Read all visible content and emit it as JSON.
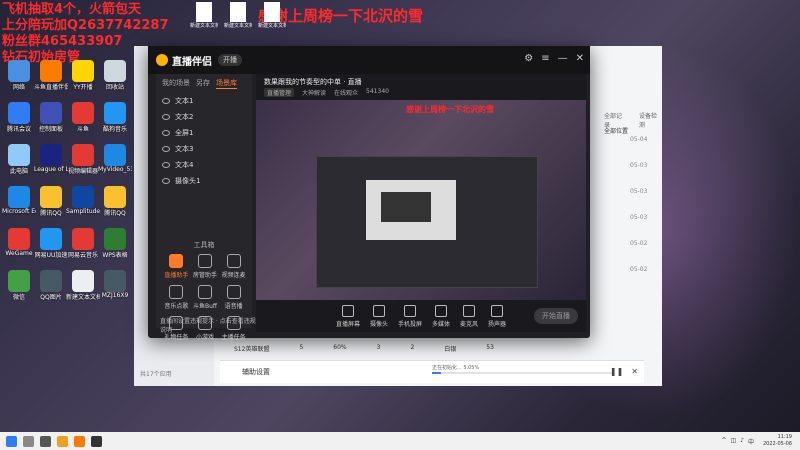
{
  "overlay": {
    "line1": "飞机抽取4个，火箭包天",
    "line2": "上分陪玩加Q2637742287",
    "line3": "粉丝群465433907",
    "line4": "钻石初始房管",
    "banner": "感谢上周榜一下北沢的雪"
  },
  "top_files": [
    "新建文本文档",
    "新建文本文档",
    "新建文本文档"
  ],
  "desktop_icons": [
    {
      "label": "网络",
      "color": "#4a90e2"
    },
    {
      "label": "斗鱼直播伴侣",
      "color": "#ff7a00"
    },
    {
      "label": "YY开播",
      "color": "#ffd400"
    },
    {
      "label": "回收站",
      "color": "#cfd8dc"
    },
    {
      "label": "腾讯会议",
      "color": "#2f7df6"
    },
    {
      "label": "控制面板",
      "color": "#3f51b5"
    },
    {
      "label": "斗鱼",
      "color": "#e53935"
    },
    {
      "label": "酷狗音乐",
      "color": "#2196f3"
    },
    {
      "label": "此电脑",
      "color": "#90caf9"
    },
    {
      "label": "League of Legends",
      "color": "#1a237e"
    },
    {
      "label": "视频编辑器",
      "color": "#e53935"
    },
    {
      "label": "MyVideo_53",
      "color": "#1e88e5"
    },
    {
      "label": "Microsoft Edge",
      "color": "#1e88e5"
    },
    {
      "label": "腾讯QQ",
      "color": "#fbc02d"
    },
    {
      "label": "SamplitudeProX",
      "color": "#0d47a1"
    },
    {
      "label": "腾讯QQ",
      "color": "#fbc02d"
    },
    {
      "label": "WeGame",
      "color": "#e53935"
    },
    {
      "label": "网易UU加速",
      "color": "#2196f3"
    },
    {
      "label": "网易云音乐",
      "color": "#e53935"
    },
    {
      "label": "WPS表格",
      "color": "#2e7d32"
    },
    {
      "label": "微信",
      "color": "#43a047"
    },
    {
      "label": "QQ图片",
      "color": "#455a64"
    },
    {
      "label": "新建文本文档",
      "color": "#eceff1"
    },
    {
      "label": "MZJ16X9",
      "color": "#455a64"
    }
  ],
  "main_window": {
    "app_name": "直播伴侣",
    "top_button": "开播",
    "left_tabs": [
      "我的场景",
      "另存",
      "场景库"
    ],
    "sources": [
      "文本1",
      "文本2",
      "全屏1",
      "文本3",
      "文本4",
      "摄像头1"
    ],
    "tools_title": "工具箱",
    "tools": [
      "直播助手",
      "房管助手",
      "视频连麦",
      "音乐点歌",
      "斗鱼Buff",
      "语音播",
      "礼物任务",
      "小游戏",
      "主播任务",
      "更多"
    ],
    "notice": "直播间设置违规提示 · 点击查看违规说明",
    "preview_title": "数果跟我的节奏型的中单 · 直播",
    "preview_info": [
      "直播管理",
      "大神解读",
      "在线观众",
      "541340"
    ],
    "bottom_buttons": [
      "直播屏幕",
      "摄像头",
      "手机投屏",
      "多媒体",
      "麦克风",
      "扬声器"
    ],
    "start_label": "开始直播",
    "canvas_banner": "感谢上周榜一下北沢的雪"
  },
  "bg_window": {
    "tabs": [
      "全部记录",
      "设备检测"
    ],
    "col_header": "全部位置",
    "dates": [
      "05-04",
      "05-03",
      "05-03",
      "05-03",
      "05-02",
      "05-02"
    ],
    "table_row": [
      "S12英雄联盟",
      "5",
      "60%",
      "3",
      "2",
      "白银",
      "53"
    ],
    "footer": "共17个应用"
  },
  "dialog": {
    "label": "辅助设置",
    "progress_text": "正在初始化... 5.05%",
    "progress": 0.0505
  },
  "tray": {
    "time": "11:19",
    "date": "2022-05-06",
    "lang": "中"
  }
}
